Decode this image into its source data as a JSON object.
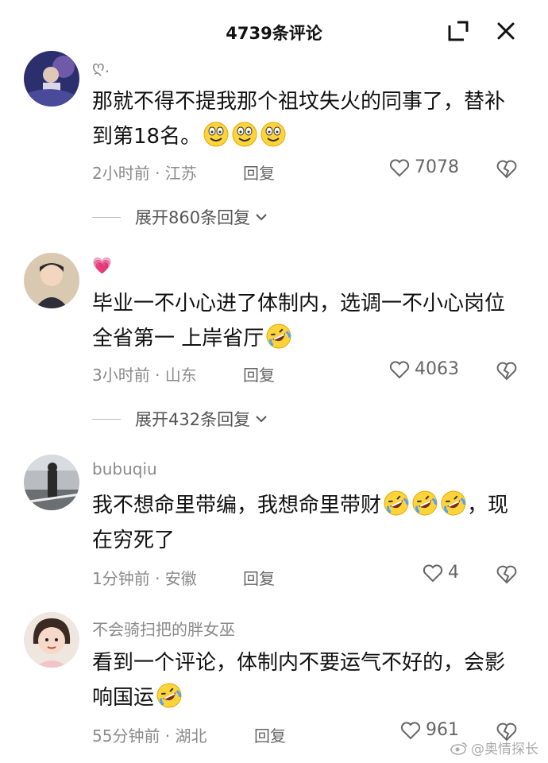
{
  "header": {
    "title": "4739条评论"
  },
  "comments": [
    {
      "username": "ღ.",
      "text": "那就不得不提我那个祖坟失火的同事了，替补到第18名。",
      "emoji": "grin-face",
      "emoji_count": 3,
      "time": "2小时前 · 江苏",
      "reply": "回复",
      "likes": "7078",
      "expand": "展开860条回复"
    },
    {
      "username": "💗",
      "text": "毕业一不小心进了体制内，选调一不小心岗位全省第一 上岸省厅",
      "emoji": "rofl-face",
      "emoji_count": 1,
      "time": "3小时前 · 山东",
      "reply": "回复",
      "likes": "4063",
      "expand": "展开432条回复"
    },
    {
      "username": "bubuqiu",
      "text": "我不想命里带编，我想命里带财",
      "text_tail": "，现在穷死了",
      "emoji": "rofl-face",
      "emoji_count": 3,
      "time": "1分钟前 · 安徽",
      "reply": "回复",
      "likes": "4"
    },
    {
      "username": "不会骑扫把的胖女巫",
      "text": "看到一个评论，体制内不要运气不好的，会影响国运",
      "emoji": "rofl-face",
      "emoji_count": 1,
      "time": "55分钟前 · 湖北",
      "reply": "回复",
      "likes": "961"
    }
  ],
  "watermark": "@奥情探长",
  "icons": {
    "minimize": "shrink-icon",
    "close": "close-icon",
    "like": "heart-icon",
    "dislike": "broken-heart-icon",
    "expand": "chevron-down-icon"
  }
}
